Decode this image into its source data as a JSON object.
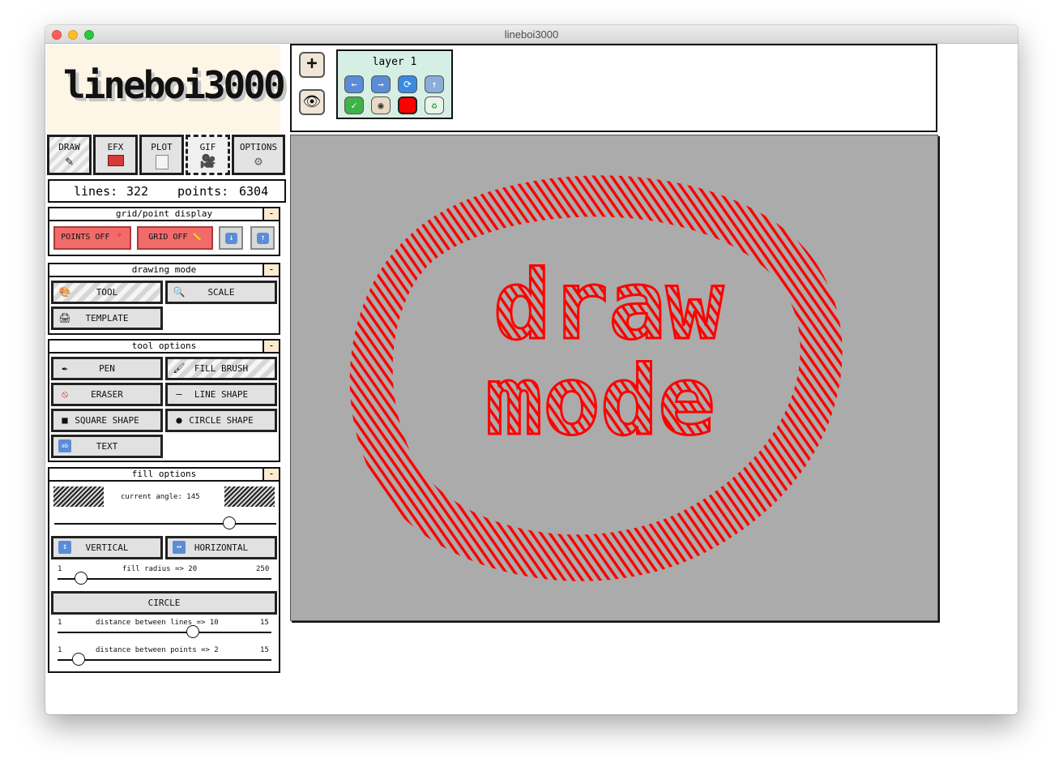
{
  "window": {
    "title": "lineboi3000"
  },
  "logo": {
    "text": "lineboi3000"
  },
  "tabs": [
    {
      "label": "DRAW",
      "icon": "pen-icon"
    },
    {
      "label": "EFX",
      "icon": "toolbox-icon"
    },
    {
      "label": "PLOT",
      "icon": "paper-icon"
    },
    {
      "label": "GIF",
      "icon": "camera-icon"
    },
    {
      "label": "OPTIONS",
      "icon": "gear-icon"
    }
  ],
  "stats": {
    "lines_label": "lines:",
    "lines_value": "322",
    "points_label": "points:",
    "points_value": "6304"
  },
  "grid_panel": {
    "title": "grid/point display",
    "collapse": "-",
    "points_button": "POINTS OFF",
    "grid_button": "GRID OFF"
  },
  "drawing_mode": {
    "title": "drawing mode",
    "collapse": "-",
    "tool": "TOOL",
    "scale": "SCALE",
    "template": "TEMPLATE"
  },
  "tool_options": {
    "title": "tool options",
    "collapse": "-",
    "pen": "PEN",
    "fill_brush": "FILL BRUSH",
    "eraser": "ERASER",
    "line_shape": "LINE SHAPE",
    "square_shape": "SQUARE SHAPE",
    "circle_shape": "CIRCLE SHAPE",
    "text": "TEXT"
  },
  "fill_options": {
    "title": "fill options",
    "collapse": "-",
    "angle_label": "current angle: 145",
    "angle": 145,
    "vertical": "VERTICAL",
    "horizontal": "HORIZONTAL",
    "radius_min": "1",
    "radius_label": "fill radius => 20",
    "radius_max": "250",
    "radius_value": 20,
    "circle": "CIRCLE",
    "lines_min": "1",
    "lines_label": "distance between lines => 10",
    "lines_max": "15",
    "lines_value": 10,
    "points_min": "1",
    "points_label": "distance between points => 2",
    "points_max": "15",
    "points_value": 2
  },
  "toolbar": {
    "add_icon": "plus-icon",
    "visibility_icon": "eye-icon",
    "layer": {
      "name": "layer 1",
      "buttons": [
        "arrow-left-icon",
        "arrow-right-icon",
        "repeat-icon",
        "upload-icon",
        "check-icon",
        "eye-icon",
        "color-swatch",
        "recycle-icon"
      ],
      "color": "#ff0000"
    }
  },
  "canvas": {
    "background": "#ababab",
    "stroke": "#ff0000",
    "text_line1": "draw",
    "text_line2": "mode"
  }
}
